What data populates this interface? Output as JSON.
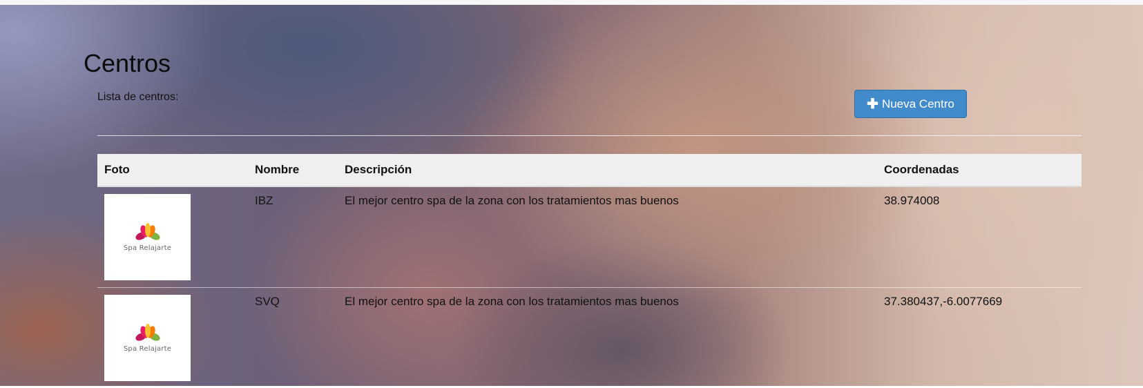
{
  "page": {
    "title": "Centros",
    "subtitle": "Lista de centros:",
    "new_button_label": "Nueva Centro"
  },
  "table": {
    "headers": {
      "foto": "Foto",
      "nombre": "Nombre",
      "descripcion": "Descripción",
      "coordenadas": "Coordenadas"
    },
    "rows": [
      {
        "photo_brand": "Spa Relajarte",
        "nombre": "IBZ",
        "descripcion": "El mejor centro spa de la zona con los tratamientos mas buenos",
        "coordenadas": "38.974008"
      },
      {
        "photo_brand": "Spa Relajarte",
        "nombre": "SVQ",
        "descripcion": "El mejor centro spa de la zona con los tratamientos mas buenos",
        "coordenadas": "37.380437,-6.0077669"
      }
    ]
  },
  "icons": {
    "new_button": "plus-icon",
    "logo": "lotus-logo-icon"
  },
  "colors": {
    "button": "#428bca",
    "header_bg": "#efefef"
  }
}
